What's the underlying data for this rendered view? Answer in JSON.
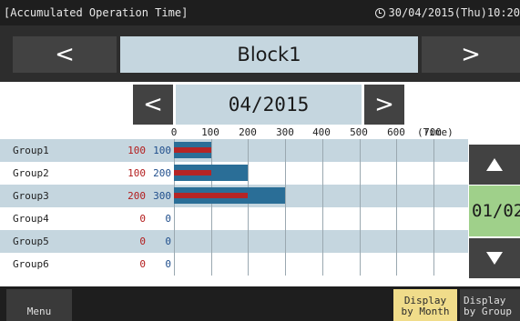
{
  "header": {
    "title": "[Accumulated Operation Time]",
    "datetime": "30/04/2015(Thu)10:20"
  },
  "block_nav": {
    "prev": "<",
    "name": "Block1",
    "next": ">"
  },
  "month_nav": {
    "prev": "<",
    "label": "04/2015",
    "next": ">"
  },
  "axis": {
    "ticks": [
      "0",
      "100",
      "200",
      "300",
      "400",
      "500",
      "600",
      "700"
    ],
    "unit": "(Time)",
    "max": 700
  },
  "colors": {
    "row_shade": "#c5d6df",
    "bar_blue": "#2a6e97",
    "bar_red": "#b52525",
    "page_indicator": "#9fd08a",
    "active_button": "#f0dc8a"
  },
  "chart_data": {
    "type": "bar",
    "categories": [
      "Group1",
      "Group2",
      "Group3",
      "Group4",
      "Group5",
      "Group6"
    ],
    "series": [
      {
        "values": [
          100,
          100,
          200,
          0,
          0,
          0
        ],
        "color": "#b52525"
      },
      {
        "values": [
          100,
          200,
          300,
          0,
          0,
          0
        ],
        "color": "#2a6e97"
      }
    ],
    "xlim": [
      0,
      700
    ],
    "xlabel": "(Time)"
  },
  "groups": [
    {
      "name": "Group1",
      "v1": "100",
      "v2": "100"
    },
    {
      "name": "Group2",
      "v1": "100",
      "v2": "200"
    },
    {
      "name": "Group3",
      "v1": "200",
      "v2": "300"
    },
    {
      "name": "Group4",
      "v1": "0",
      "v2": "0"
    },
    {
      "name": "Group5",
      "v1": "0",
      "v2": "0"
    },
    {
      "name": "Group6",
      "v1": "0",
      "v2": "0"
    }
  ],
  "pager": {
    "up_icon": "triangle-up-icon",
    "page": "01/02",
    "down_icon": "triangle-down-icon"
  },
  "footer": {
    "menu": "Menu",
    "by_month_line1": "Display",
    "by_month_line2": "by Month",
    "by_group_line1": "Display",
    "by_group_line2": "by Group"
  }
}
